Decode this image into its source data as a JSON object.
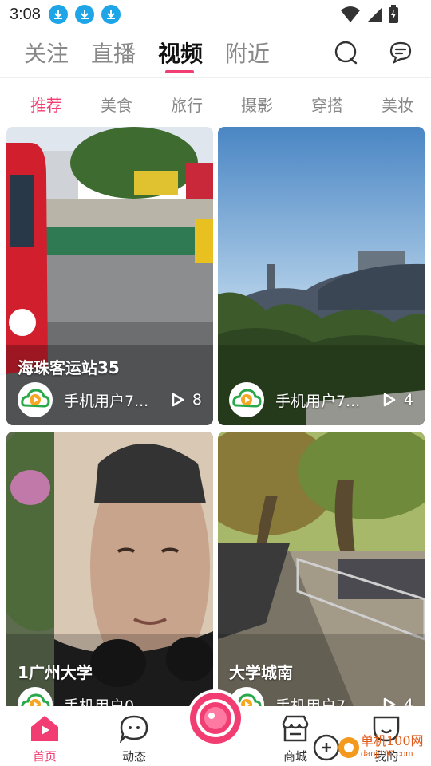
{
  "status_bar": {
    "time": "3:08",
    "download_icons": [
      "download-icon",
      "download-icon",
      "download-icon"
    ],
    "indicators": [
      "wifi-icon",
      "signal-icon",
      "battery-icon"
    ]
  },
  "top_tabs": {
    "items": [
      "关注",
      "直播",
      "视频",
      "附近"
    ],
    "active": "视频",
    "accent_color": "#f23d72"
  },
  "categories": {
    "items": [
      "推荐",
      "美食",
      "旅行",
      "摄影",
      "穿搭",
      "美妆"
    ],
    "active": "推荐"
  },
  "cards": [
    {
      "title": "海珠客运站35",
      "author": "手机用户7...",
      "plays": "8"
    },
    {
      "title": "",
      "author": "手机用户7...",
      "plays": "4"
    },
    {
      "title": "1广州大学",
      "author": "手机用户0",
      "plays": ""
    },
    {
      "title": "大学城南",
      "author": "手机用户7",
      "plays": "4"
    }
  ],
  "bottom_nav": {
    "items": [
      "首页",
      "动态",
      "商城",
      "我的"
    ],
    "active": "首页"
  },
  "watermark": {
    "text": "单机100网",
    "url": "danji100.com"
  }
}
